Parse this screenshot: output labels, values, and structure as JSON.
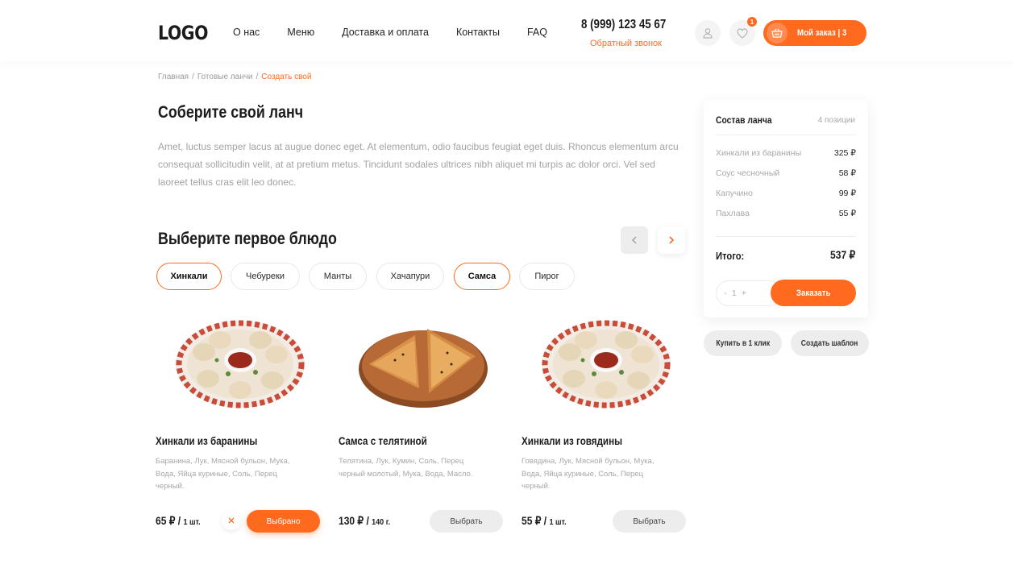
{
  "header": {
    "logo": "LOGO",
    "nav": [
      "О нас",
      "Меню",
      "Доставка и оплата",
      "Контакты",
      "FAQ"
    ],
    "phone": "8 (999) 123 45 67",
    "callback": "Обратный звонок",
    "favorites_count": "1",
    "cart_label": "Мой заказ  |  3"
  },
  "breadcrumb": {
    "items": [
      "Главная",
      "Готовые ланчи",
      "Создать свой"
    ],
    "separator": "/"
  },
  "page": {
    "title": "Соберите свой ланч",
    "intro": "Amet, luctus semper lacus at augue donec eget. At elementum, odio faucibus feugiat eget duis. Rhoncus elementum arcu consequat sollicitudin velit, at at pretium metus. Tincidunt sodales ultrices nibh aliquet mi turpis ac dolor orci. Vel sed laoreet tellus cras elit leo donec."
  },
  "section": {
    "title": "Выберите первое блюдо",
    "chips": [
      {
        "label": "Хинкали",
        "active": true
      },
      {
        "label": "Чебуреки",
        "active": false
      },
      {
        "label": "Манты",
        "active": false
      },
      {
        "label": "Хачапури",
        "active": false
      },
      {
        "label": "Самса",
        "active": true
      },
      {
        "label": "Пирог",
        "active": false
      }
    ]
  },
  "products": [
    {
      "name": "Хинкали из баранины",
      "desc": "Баранина, Лук, Мясной бульон, Мука, Вода, Яйца куриные, Соль, Перец черный.",
      "price": "65 ₽ / ",
      "unit": "1 шт.",
      "button": "Выбрано",
      "selected": true
    },
    {
      "name": "Самса с телятиной",
      "desc": "Телятина, Лук, Кумин, Соль, Перец черный молотый, Мука, Вода, Масло.",
      "price": "130 ₽ / ",
      "unit": "140 г.",
      "button": "Выбрать",
      "selected": false
    },
    {
      "name": "Хинкали из говядины",
      "desc": "Говядина, Лук, Мясной бульон, Мука, Вода, Яйца куриные, Соль, Перец черный.",
      "price": "55 ₽ / ",
      "unit": "1 шт.",
      "button": "Выбрать",
      "selected": false
    }
  ],
  "summary": {
    "title": "Состав ланча",
    "count": "4 позиции",
    "items": [
      {
        "label": "Хинкали из баранины",
        "value": "325 ₽"
      },
      {
        "label": "Соус чесночный",
        "value": "58 ₽"
      },
      {
        "label": "Капучино",
        "value": "99 ₽"
      },
      {
        "label": "Пахлава",
        "value": "55 ₽"
      }
    ],
    "total_label": "Итого:",
    "total_value": "537 ₽",
    "qty_minus": "-",
    "qty_value": "1",
    "qty_plus": "+",
    "order_button": "Заказать"
  },
  "actions": {
    "buy_one_click": "Купить в 1 клик",
    "create_template": "Создать шаблон"
  },
  "colors": {
    "accent": "#ff6a1f",
    "text": "#1c1c1c",
    "muted": "#a3a3a3",
    "chip_border": "#e8e8e8",
    "button_gray": "#ededed"
  },
  "icons": [
    "user-icon",
    "heart-icon",
    "basket-icon",
    "chevron-left-icon",
    "chevron-right-icon",
    "close-icon"
  ]
}
